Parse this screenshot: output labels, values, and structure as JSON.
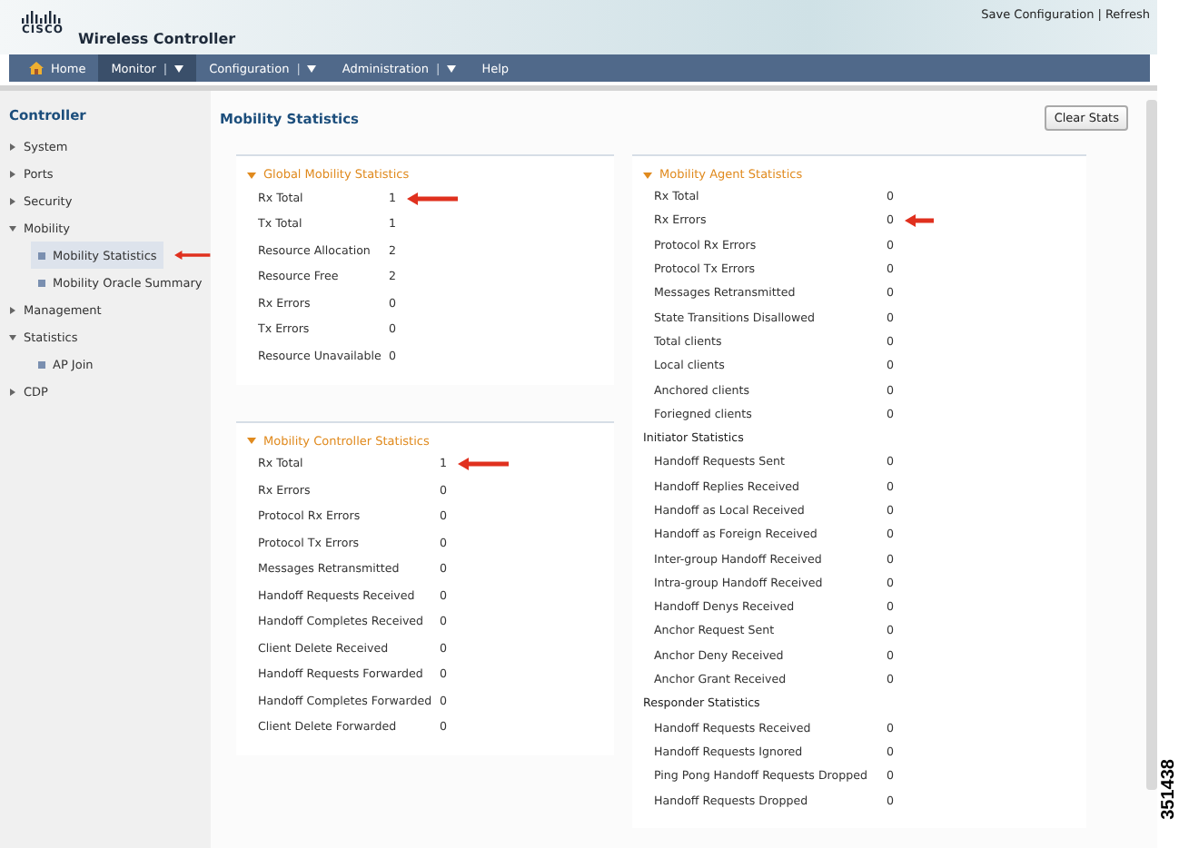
{
  "header": {
    "logo": "CISCO",
    "product": "Wireless Controller",
    "links": [
      "Save Configuration",
      "Refresh"
    ],
    "separator": "|",
    "dropdown_separator": "|"
  },
  "nav": [
    {
      "label": "Home",
      "kind": "home",
      "selected": false,
      "dropdown": false
    },
    {
      "label": "Monitor",
      "kind": "menu",
      "selected": true,
      "dropdown": true
    },
    {
      "label": "Configuration",
      "kind": "menu",
      "selected": false,
      "dropdown": true
    },
    {
      "label": "Administration",
      "kind": "menu",
      "selected": false,
      "dropdown": true
    },
    {
      "label": "Help",
      "kind": "menu",
      "selected": false,
      "dropdown": false
    }
  ],
  "sidebar": {
    "title": "Controller",
    "items": [
      {
        "label": "System",
        "expanded": false
      },
      {
        "label": "Ports",
        "expanded": false
      },
      {
        "label": "Security",
        "expanded": false
      },
      {
        "label": "Mobility",
        "expanded": true,
        "children": [
          {
            "label": "Mobility Statistics",
            "selected": true,
            "arrow": true
          },
          {
            "label": "Mobility Oracle Summary",
            "selected": false,
            "arrow": false
          }
        ]
      },
      {
        "label": "Management",
        "expanded": false
      },
      {
        "label": "Statistics",
        "expanded": true,
        "children": [
          {
            "label": "AP Join",
            "selected": false,
            "arrow": false
          }
        ]
      },
      {
        "label": "CDP",
        "expanded": false
      }
    ]
  },
  "page": {
    "title": "Mobility Statistics",
    "clear_button": "Clear Stats"
  },
  "panels": [
    {
      "title": "Global Mobility Statistics",
      "expanded": true,
      "rows": [
        {
          "kind": "stat",
          "label": "Rx Total",
          "value": "1",
          "arrow": true
        },
        {
          "kind": "stat",
          "label": "Tx Total",
          "value": "1",
          "arrow": false
        },
        {
          "kind": "stat",
          "label": "Resource Allocation",
          "value": "2",
          "arrow": false
        },
        {
          "kind": "stat",
          "label": "Resource Free",
          "value": "2",
          "arrow": false
        },
        {
          "kind": "stat",
          "label": "Rx Errors",
          "value": "0",
          "arrow": false
        },
        {
          "kind": "stat",
          "label": "Tx Errors",
          "value": "0",
          "arrow": false
        },
        {
          "kind": "stat",
          "label": "Resource Unavailable",
          "value": "0",
          "arrow": false
        }
      ]
    },
    {
      "title": "Mobility Controller Statistics",
      "expanded": true,
      "rows": [
        {
          "kind": "stat",
          "label": "Rx Total",
          "value": "1",
          "arrow": true
        },
        {
          "kind": "stat",
          "label": "Rx Errors",
          "value": "0",
          "arrow": false
        },
        {
          "kind": "stat",
          "label": "Protocol Rx Errors",
          "value": "0",
          "arrow": false
        },
        {
          "kind": "stat",
          "label": "Protocol Tx Errors",
          "value": "0",
          "arrow": false
        },
        {
          "kind": "stat",
          "label": "Messages Retransmitted",
          "value": "0",
          "arrow": false
        },
        {
          "kind": "stat",
          "label": "Handoff Requests Received",
          "value": "0",
          "arrow": false
        },
        {
          "kind": "stat",
          "label": "Handoff Completes Received",
          "value": "0",
          "arrow": false
        },
        {
          "kind": "stat",
          "label": "Client Delete Received",
          "value": "0",
          "arrow": false
        },
        {
          "kind": "stat",
          "label": "Handoff Requests Forwarded",
          "value": "0",
          "arrow": false
        },
        {
          "kind": "stat",
          "label": "Handoff Completes Forwarded",
          "value": "0",
          "arrow": false
        },
        {
          "kind": "stat",
          "label": "Client Delete Forwarded",
          "value": "0",
          "arrow": false
        }
      ]
    },
    {
      "title": "Mobility Agent Statistics",
      "expanded": true,
      "rows": [
        {
          "kind": "stat",
          "label": "Rx Total",
          "value": "0",
          "arrow": false
        },
        {
          "kind": "stat",
          "label": "Rx Errors",
          "value": "0",
          "arrow": true
        },
        {
          "kind": "stat",
          "label": "Protocol Rx Errors",
          "value": "0",
          "arrow": false
        },
        {
          "kind": "stat",
          "label": "Protocol Tx Errors",
          "value": "0",
          "arrow": false
        },
        {
          "kind": "stat",
          "label": "Messages Retransmitted",
          "value": "0",
          "arrow": false
        },
        {
          "kind": "stat",
          "label": "State Transitions Disallowed",
          "value": "0",
          "arrow": false
        },
        {
          "kind": "stat",
          "label": "Total clients",
          "value": "0",
          "arrow": false
        },
        {
          "kind": "stat",
          "label": "Local clients",
          "value": "0",
          "arrow": false
        },
        {
          "kind": "stat",
          "label": "Anchored clients",
          "value": "0",
          "arrow": false
        },
        {
          "kind": "stat",
          "label": "Foriegned clients",
          "value": "0",
          "arrow": false
        },
        {
          "kind": "heading",
          "label": "Initiator Statistics"
        },
        {
          "kind": "stat",
          "label": "Handoff Requests Sent",
          "value": "0",
          "arrow": false
        },
        {
          "kind": "stat",
          "label": "Handoff Replies Received",
          "value": "0",
          "arrow": false
        },
        {
          "kind": "stat",
          "label": "Handoff as Local Received",
          "value": "0",
          "arrow": false
        },
        {
          "kind": "stat",
          "label": "Handoff as Foreign Received",
          "value": "0",
          "arrow": false
        },
        {
          "kind": "stat",
          "label": "Inter-group Handoff Received",
          "value": "0",
          "arrow": false
        },
        {
          "kind": "stat",
          "label": "Intra-group Handoff Received",
          "value": "0",
          "arrow": false
        },
        {
          "kind": "stat",
          "label": "Handoff Denys Received",
          "value": "0",
          "arrow": false
        },
        {
          "kind": "stat",
          "label": "Anchor Request Sent",
          "value": "0",
          "arrow": false
        },
        {
          "kind": "stat",
          "label": "Anchor Deny Received",
          "value": "0",
          "arrow": false
        },
        {
          "kind": "stat",
          "label": "Anchor Grant Received",
          "value": "0",
          "arrow": false
        },
        {
          "kind": "heading",
          "label": "Responder Statistics"
        },
        {
          "kind": "stat",
          "label": "Handoff Requests Received",
          "value": "0",
          "arrow": false
        },
        {
          "kind": "stat",
          "label": "Handoff Requests Ignored",
          "value": "0",
          "arrow": false
        },
        {
          "kind": "stat",
          "label": "Ping Pong Handoff Requests Dropped",
          "value": "0",
          "arrow": false
        },
        {
          "kind": "stat",
          "label": "Handoff Requests Dropped",
          "value": "0",
          "arrow": false
        }
      ]
    }
  ],
  "figure_id": "351438"
}
